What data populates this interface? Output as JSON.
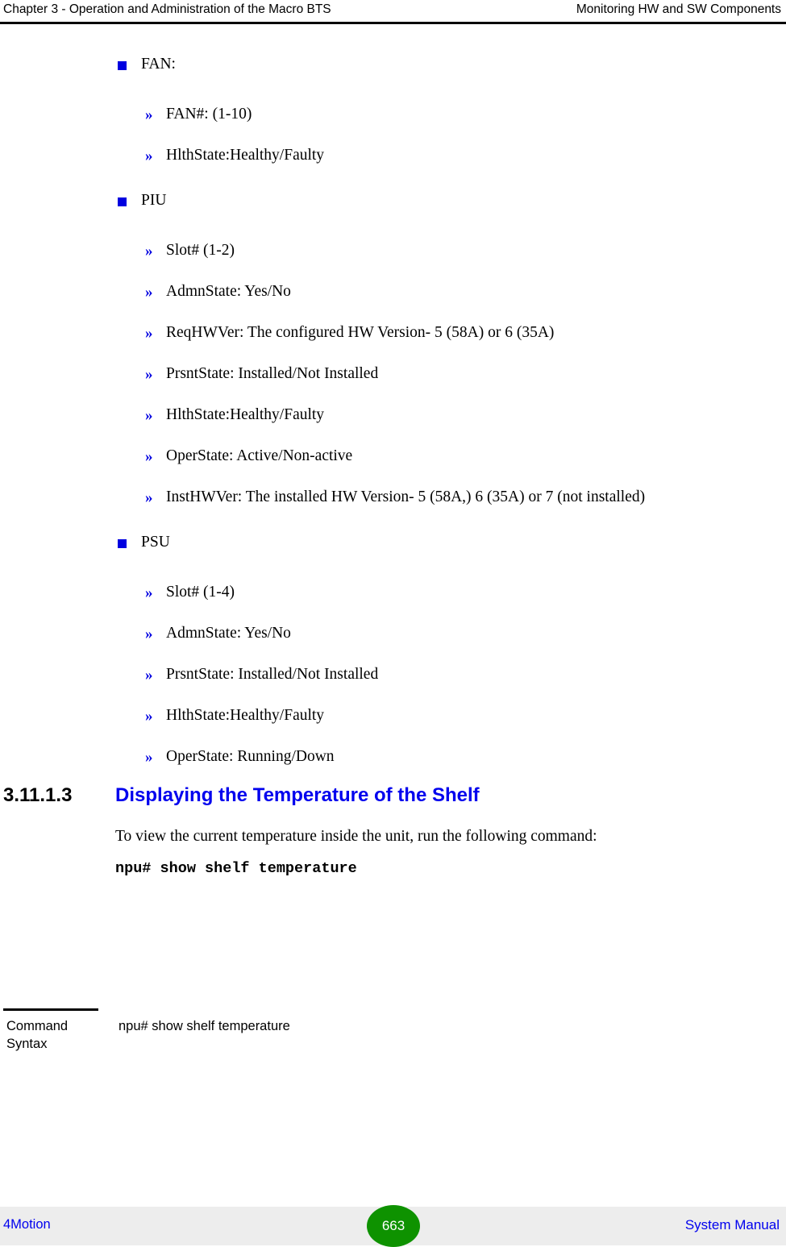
{
  "header": {
    "left": "Chapter 3 - Operation and Administration of the Macro BTS",
    "right": "Monitoring HW and SW Components"
  },
  "bullet_glyph": "»",
  "groups": [
    {
      "title": "FAN:",
      "items": [
        "FAN#: (1-10)",
        "HlthState:Healthy/Faulty"
      ]
    },
    {
      "title": "PIU",
      "items": [
        "Slot# (1-2)",
        "AdmnState: Yes/No",
        "ReqHWVer: The configured HW Version- 5 (58A) or 6 (35A)",
        "PrsntState: Installed/Not Installed",
        "HlthState:Healthy/Faulty",
        "OperState: Active/Non-active",
        "InstHWVer: The installed HW Version- 5 (58A,) 6 (35A) or 7 (not installed)"
      ]
    },
    {
      "title": "PSU",
      "items": [
        "Slot# (1-4)",
        "AdmnState: Yes/No",
        "PrsntState: Installed/Not Installed",
        "HlthState:Healthy/Faulty",
        "OperState: Running/Down"
      ]
    }
  ],
  "section": {
    "number": "3.11.1.3",
    "title": "Displaying the Temperature of the Shelf",
    "paragraph": "To view the current temperature inside the unit, run the following command:",
    "command": "npu# show shelf temperature"
  },
  "command_table": {
    "label_line1": "Command",
    "label_line2": "Syntax",
    "value": "npu# show shelf temperature"
  },
  "footer": {
    "left": "4Motion",
    "page": "663",
    "right": "System Manual"
  },
  "colors": {
    "bullet_blue": "#0000E0",
    "heading_blue": "#0000EE",
    "page_badge_green": "#0E9200",
    "footer_bg": "#EDEDED"
  }
}
